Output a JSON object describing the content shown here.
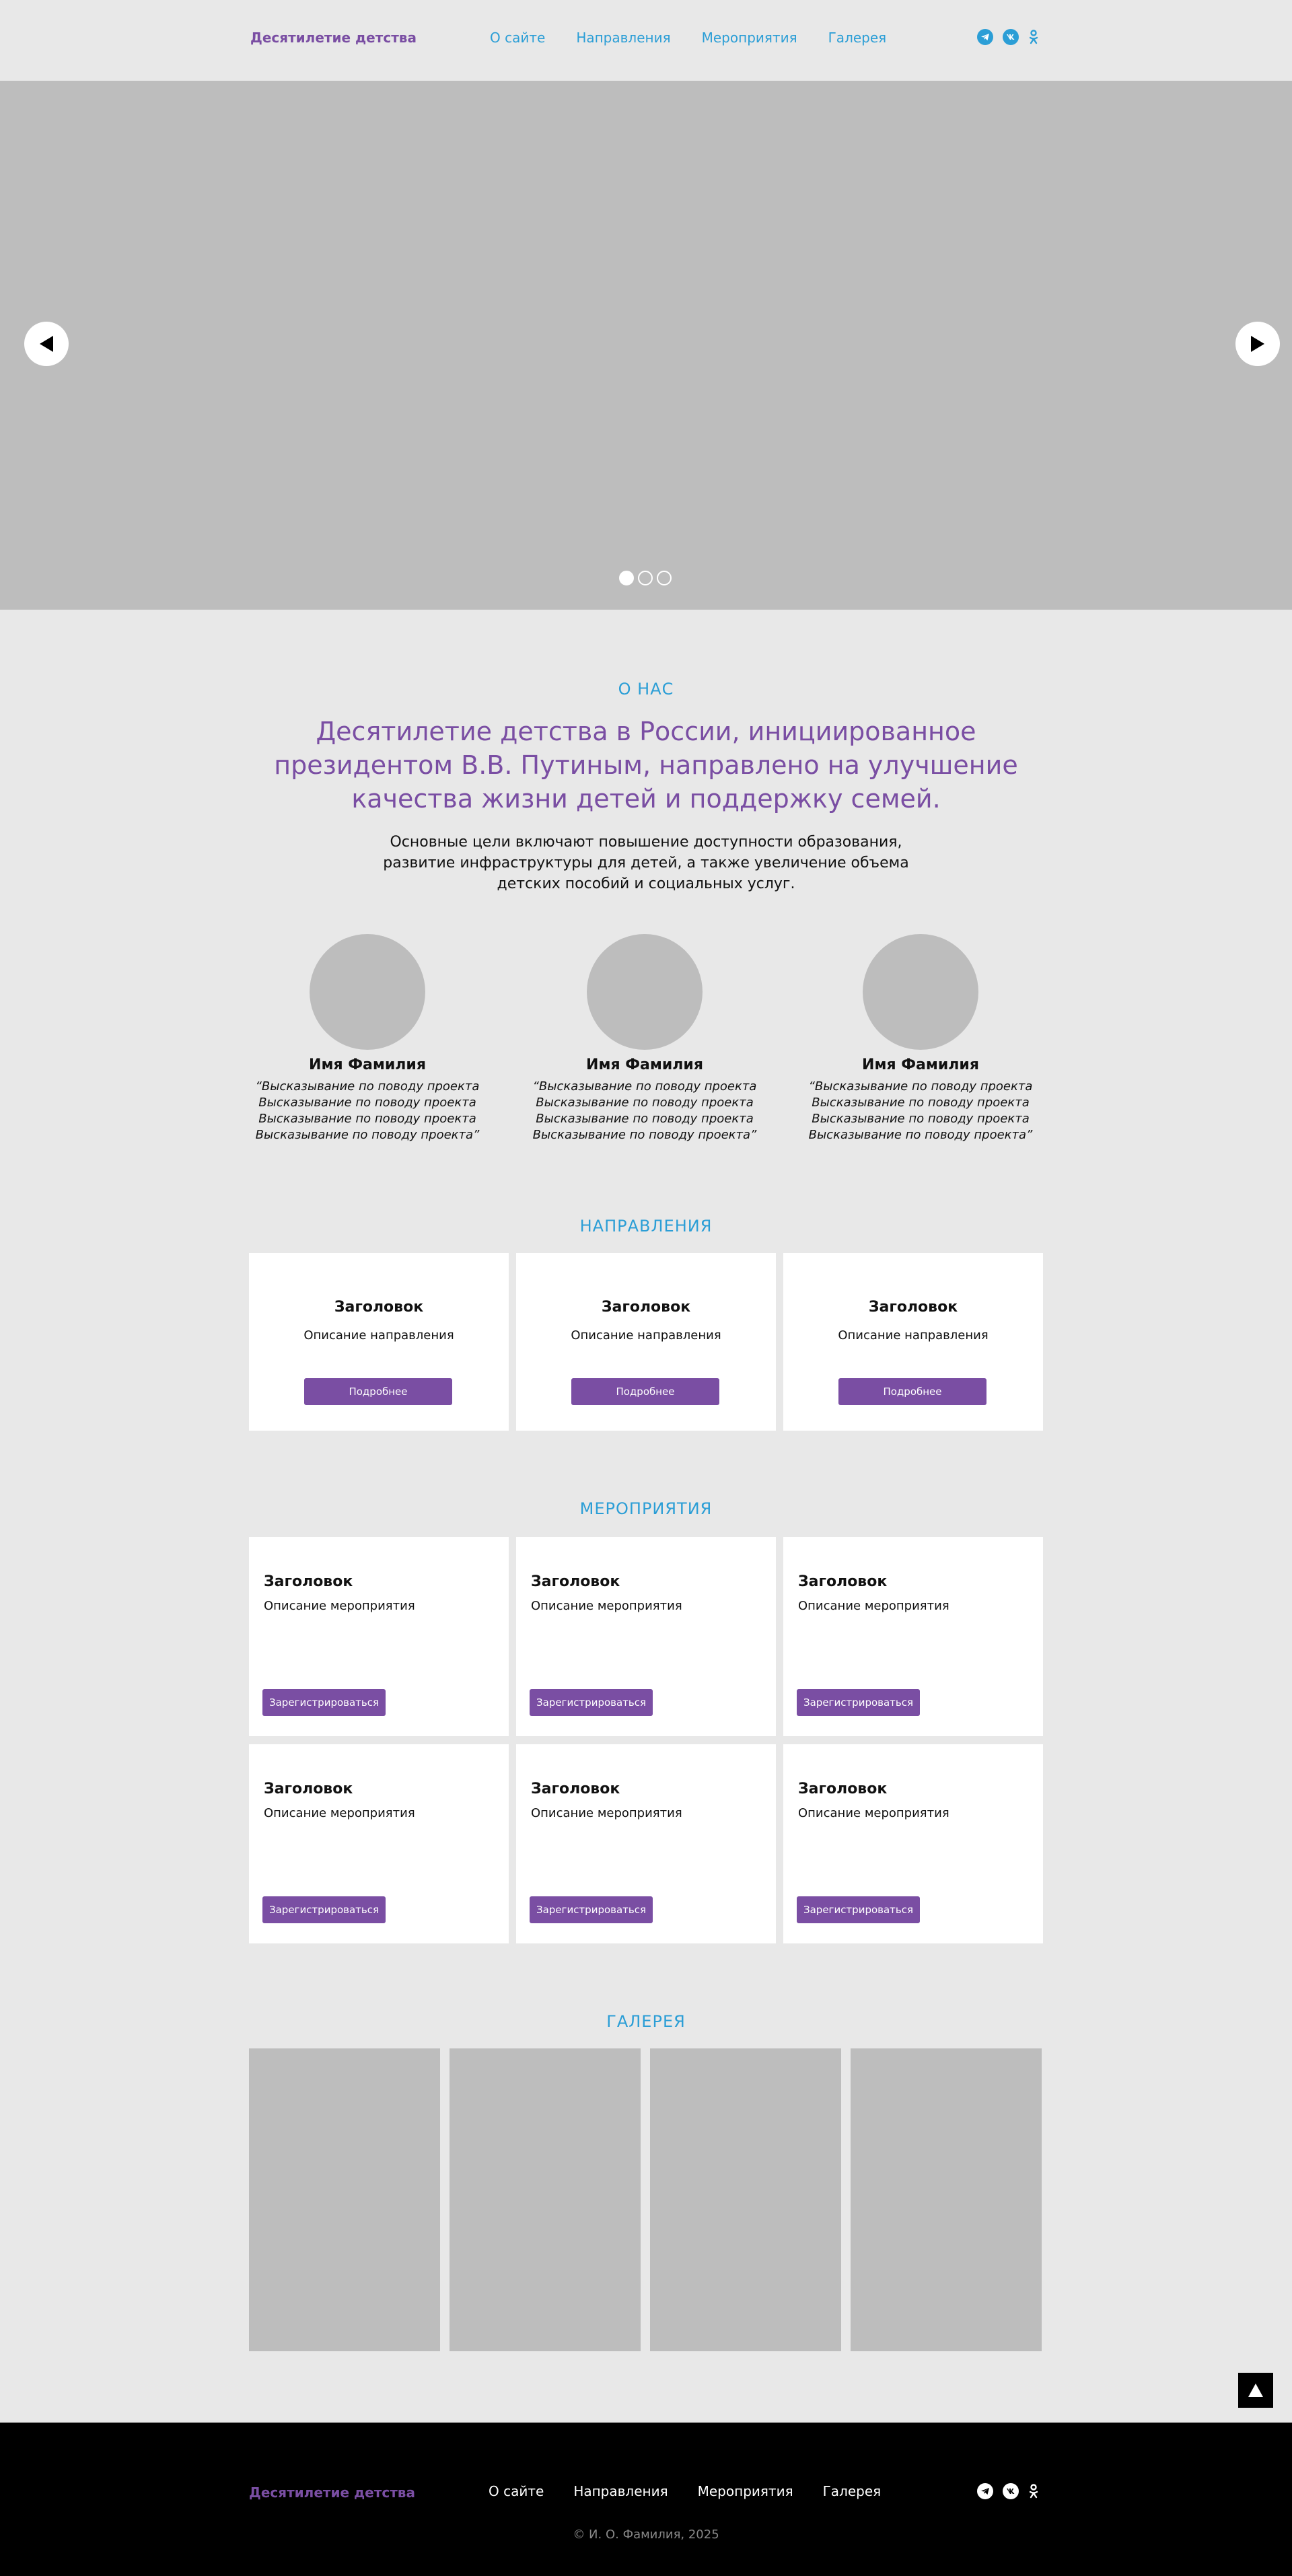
{
  "header": {
    "logo": "Десятилетие детства",
    "nav": [
      "О сайте",
      "Направления",
      "Мероприятия",
      "Галерея"
    ],
    "social": [
      "telegram-icon",
      "vk-icon",
      "odnoklassniki-icon"
    ]
  },
  "hero": {
    "slides_count": 3,
    "active_slide": 1
  },
  "about": {
    "label": "О НАС",
    "title": "Десятилетие детства в России, инициированное президентом В.В. Путиным, направлено на улучшение качества жизни детей и поддержку семей.",
    "text": "Основные цели включают повышение доступности образования, развитие инфраструктуры для детей, а также увеличение объема детских пособий и социальных услуг.",
    "people": [
      {
        "name": "Имя Фамилия",
        "quote": "“Высказывание по поводу проекта Высказывание по поводу проекта Высказывание по поводу проекта Высказывание по поводу проекта”"
      },
      {
        "name": "Имя Фамилия",
        "quote": "“Высказывание по поводу проекта Высказывание по поводу проекта Высказывание по поводу проекта Высказывание по поводу проекта”"
      },
      {
        "name": "Имя Фамилия",
        "quote": "“Высказывание по поводу проекта Высказывание по поводу проекта Высказывание по поводу проекта Высказывание по поводу проекта”"
      }
    ]
  },
  "directions": {
    "label": "НАПРАВЛЕНИЯ",
    "cards": [
      {
        "title": "Заголовок",
        "desc": "Описание направления",
        "button": "Подробнее"
      },
      {
        "title": "Заголовок",
        "desc": "Описание направления",
        "button": "Подробнее"
      },
      {
        "title": "Заголовок",
        "desc": "Описание направления",
        "button": "Подробнее"
      }
    ]
  },
  "events": {
    "label": "МЕРОПРИЯТИЯ",
    "cards": [
      {
        "title": "Заголовок",
        "desc": "Описание мероприятия",
        "button": "Зарегистрироваться"
      },
      {
        "title": "Заголовок",
        "desc": "Описание мероприятия",
        "button": "Зарегистрироваться"
      },
      {
        "title": "Заголовок",
        "desc": "Описание мероприятия",
        "button": "Зарегистрироваться"
      },
      {
        "title": "Заголовок",
        "desc": "Описание мероприятия",
        "button": "Зарегистрироваться"
      },
      {
        "title": "Заголовок",
        "desc": "Описание мероприятия",
        "button": "Зарегистрироваться"
      },
      {
        "title": "Заголовок",
        "desc": "Описание мероприятия",
        "button": "Зарегистрироваться"
      }
    ]
  },
  "gallery": {
    "label": "ГАЛЕРЕЯ",
    "images_count": 4
  },
  "footer": {
    "logo": "Десятилетие детства",
    "nav": [
      "О сайте",
      "Направления",
      "Мероприятия",
      "Галерея"
    ],
    "copyright": "© И. О. Фамилия, 2025"
  },
  "colors": {
    "accent_purple": "#7a4ea3",
    "accent_blue": "#2b9ed6",
    "background": "#e8e8e8",
    "placeholder_gray": "#bdbdbd",
    "footer_bg": "#000000"
  }
}
